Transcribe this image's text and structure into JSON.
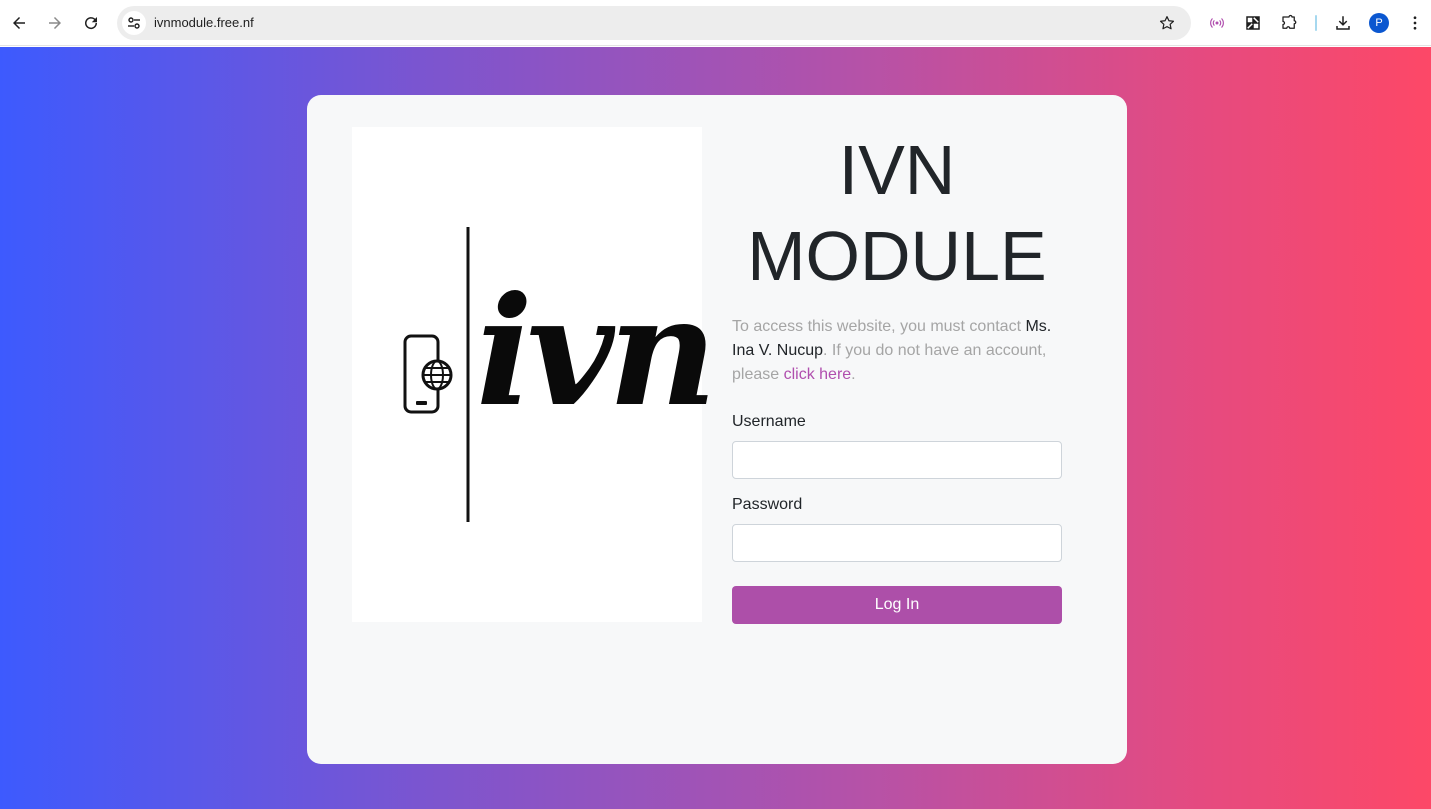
{
  "browser": {
    "url": "ivnmodule.free.nf",
    "profile_initial": "P",
    "icons": {
      "back": "arrow-left-icon",
      "forward": "arrow-right-icon",
      "reload": "reload-icon",
      "site_info": "tune-icon",
      "bookmark": "star-icon",
      "extension_1": "broadcast-icon",
      "extension_2": "puzzle-grid-icon",
      "extensions": "puzzle-icon",
      "downloads": "download-icon",
      "menu": "kebab-menu-icon"
    }
  },
  "colors": {
    "gradient_start": "#3d5afe",
    "gradient_end": "#fd4867",
    "accent": "#ad4fa9",
    "link": "#b04fae"
  },
  "logo": {
    "text": "ivn"
  },
  "login": {
    "title_line1": "IVN",
    "title_line2": "MODULE",
    "info_part1": "To access this website, you must contact ",
    "info_contact": "Ms. Ina V. Nucup",
    "info_part2": ". If you do not have an account, please ",
    "info_link": "click here",
    "info_part3": ".",
    "username_label": "Username",
    "username_value": "",
    "password_label": "Password",
    "password_value": "",
    "submit_label": "Log In"
  }
}
